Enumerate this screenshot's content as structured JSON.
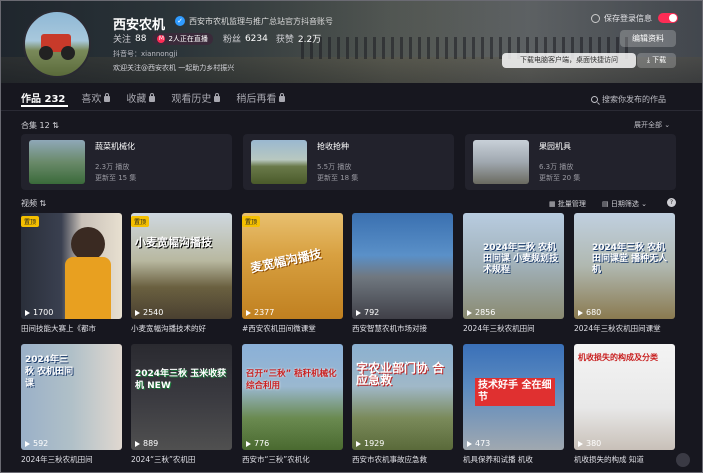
{
  "profile": {
    "name": "西安农机",
    "org": "西安市农机监理与推广总站官方抖音账号",
    "following_label": "关注",
    "following": "88",
    "live_text": "2人正在直播",
    "fans_label": "粉丝",
    "fans": "6234",
    "likes_label": "获赞",
    "likes": "2.2万",
    "uid": "抖音号：xiannongji",
    "bio": "欢迎关注@西安农机 一起助力乡村振兴"
  },
  "header_actions": {
    "save_login": "保存登录信息",
    "edit": "编辑资料",
    "download_tip": "下载电脑客户端，桌面快捷访问",
    "download": "下载"
  },
  "tabs": [
    {
      "label": "作品 232"
    },
    {
      "label": "喜欢"
    },
    {
      "label": "收藏"
    },
    {
      "label": "观看历史"
    },
    {
      "label": "稍后再看"
    }
  ],
  "search_placeholder": "搜索你发布的作品",
  "collections_label": "合集 12",
  "expand_all": "展开全部",
  "collections": [
    {
      "title": "蔬菜机械化",
      "plays": "2.3万 播放",
      "updated": "更新至 15 集"
    },
    {
      "title": "抢收抢种",
      "plays": "5.5万 播放",
      "updated": "更新至 18 集"
    },
    {
      "title": "果园机具",
      "plays": "6.3万 播放",
      "updated": "更新至 20 集"
    }
  ],
  "videos_label": "视频",
  "tools": {
    "batch": "批量管理",
    "date_filter": "日期筛选"
  },
  "pin_label": "置顶",
  "videos": [
    {
      "plays": "1700",
      "caption": "田间技能大赛上《都市",
      "pinned": true
    },
    {
      "plays": "2540",
      "caption": "小麦宽幅沟播技术的好",
      "pinned": true,
      "overlay": "小麦宽幅沟播技"
    },
    {
      "plays": "2377",
      "caption": "#西安农机田间微课堂",
      "pinned": true,
      "overlay": "麦宽幅沟播技"
    },
    {
      "plays": "792",
      "caption": "西安智慧农机市场对接"
    },
    {
      "plays": "2856",
      "caption": "2024年三秋农机田间",
      "overlay": "2024年三秋 农机田间课 小麦规划技术规程"
    },
    {
      "plays": "680",
      "caption": "2024年三秋农机田间课堂",
      "overlay": "2024年三秋 农机田间课堂 播种无人机"
    },
    {
      "plays": "592",
      "caption": "2024年三秋农机田间",
      "overlay": "2024年三秋 农机田间课"
    },
    {
      "plays": "889",
      "caption": "2024“三秋”农机田",
      "overlay": "2024年三秋 玉米收获机 NEW"
    },
    {
      "plays": "776",
      "caption": "西安市“三秋”农机化",
      "overlay": "召开“三秋” 秸秆机械化综合利用"
    },
    {
      "plays": "1929",
      "caption": "西安市农机事故应急救",
      "overlay": "字农业部门协 合应急救"
    },
    {
      "plays": "473",
      "caption": "机具保养和试播 机收",
      "overlay": "技术好手 全在细节"
    },
    {
      "plays": "380",
      "caption": "机收损失的构成 知道",
      "overlay": "机收损失的构成及分类"
    }
  ]
}
